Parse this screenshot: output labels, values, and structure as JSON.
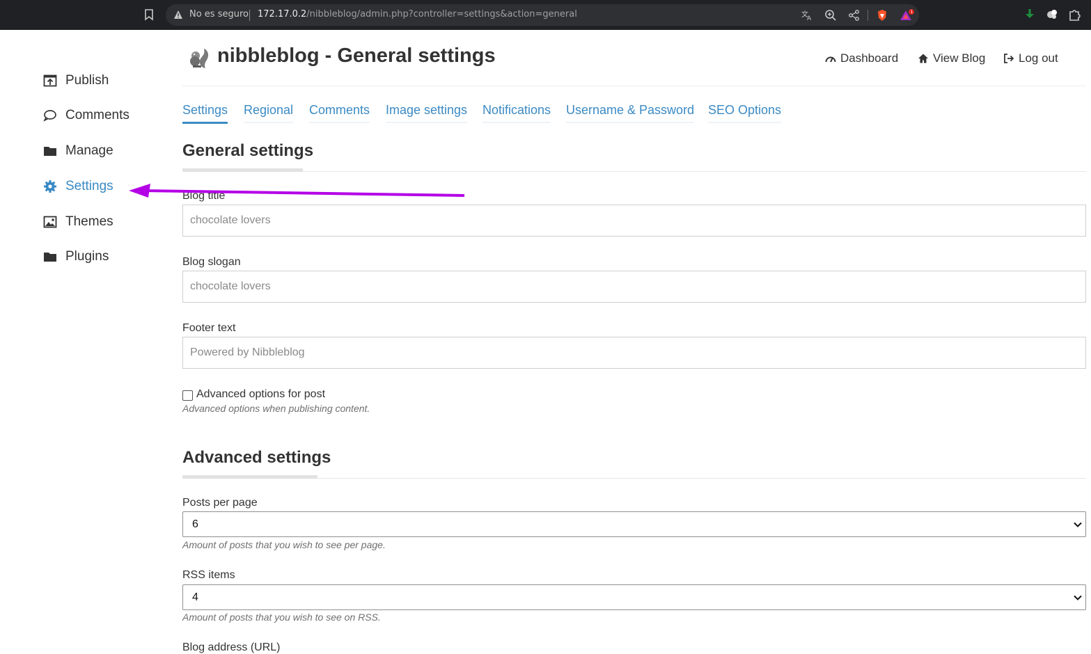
{
  "browser": {
    "security_label": "No es seguro",
    "url_host": "172.17.0.2",
    "url_path": "/nibbleblog/admin.php?controller=settings&action=general",
    "notification_count": "1"
  },
  "sidebar": {
    "items": [
      {
        "label": "Publish",
        "icon": "publish-icon"
      },
      {
        "label": "Comments",
        "icon": "comment-icon"
      },
      {
        "label": "Manage",
        "icon": "folder-icon"
      },
      {
        "label": "Settings",
        "icon": "gear-icon",
        "active": true
      },
      {
        "label": "Themes",
        "icon": "image-icon"
      },
      {
        "label": "Plugins",
        "icon": "folder-icon"
      }
    ]
  },
  "header": {
    "title": "nibbleblog - General settings",
    "links": {
      "dashboard": "Dashboard",
      "view_blog": "View Blog",
      "log_out": "Log out"
    }
  },
  "tabs": [
    {
      "label": "Settings",
      "active": true
    },
    {
      "label": "Regional"
    },
    {
      "label": "Comments"
    },
    {
      "label": "Image settings"
    },
    {
      "label": "Notifications"
    },
    {
      "label": "Username & Password"
    },
    {
      "label": "SEO Options"
    }
  ],
  "general": {
    "heading": "General settings",
    "blog_title": {
      "label": "Blog title",
      "value": "chocolate lovers"
    },
    "blog_slogan": {
      "label": "Blog slogan",
      "value": "chocolate lovers"
    },
    "footer_text": {
      "label": "Footer text",
      "value": "Powered by Nibbleblog"
    },
    "advanced_options": {
      "label": "Advanced options for post",
      "help": "Advanced options when publishing content.",
      "checked": false
    }
  },
  "advanced": {
    "heading": "Advanced settings",
    "posts_per_page": {
      "label": "Posts per page",
      "value": "6",
      "help": "Amount of posts that you wish to see per page."
    },
    "rss_items": {
      "label": "RSS items",
      "value": "4",
      "help": "Amount of posts that you wish to see on RSS."
    },
    "blog_address": {
      "label": "Blog address (URL)"
    }
  },
  "colors": {
    "accent": "#3b8ac4",
    "annotation_arrow": "#b400e6",
    "browser_bar": "#202124"
  }
}
